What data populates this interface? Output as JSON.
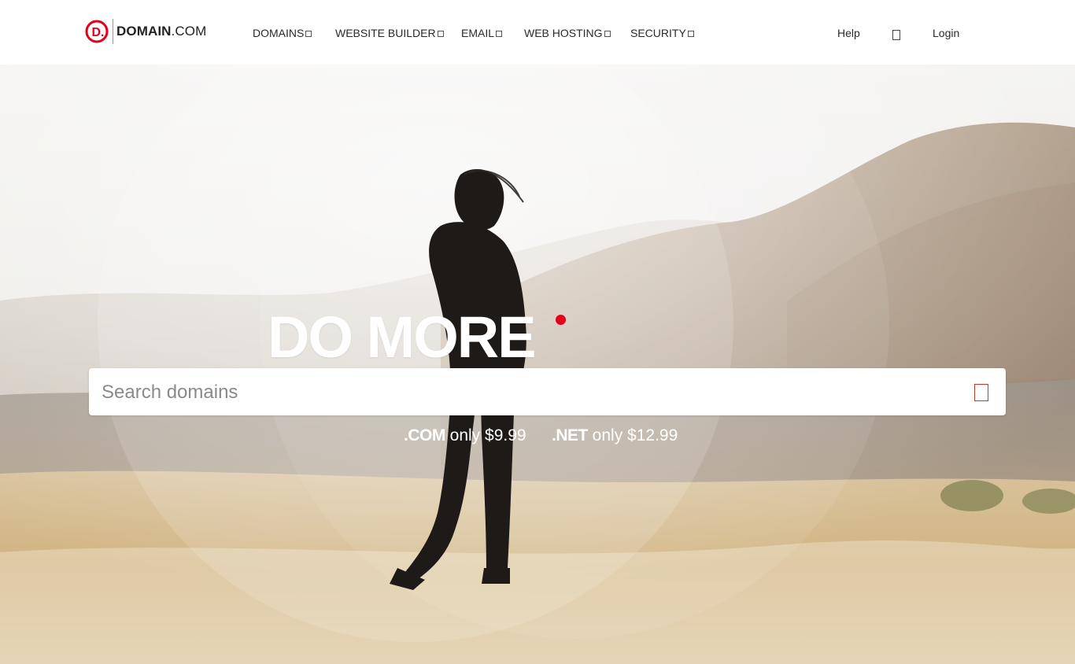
{
  "header": {
    "logo_mark": "D.",
    "logo_bold": "DOMAIN",
    "logo_suffix": ".COM",
    "nav": [
      {
        "label": "DOMAINS"
      },
      {
        "label": "WEBSITE BUILDER"
      },
      {
        "label": "EMAIL"
      },
      {
        "label": "WEB HOSTING"
      },
      {
        "label": "SECURITY"
      }
    ],
    "help_label": "Help",
    "login_label": "Login"
  },
  "hero": {
    "headline": "DO MORE",
    "accent_color": "#e3001b",
    "search": {
      "placeholder": "Search domains",
      "value": ""
    },
    "pricing": [
      {
        "tld": ".COM",
        "text": " only $9.99"
      },
      {
        "tld": ".NET",
        "text": " only $12.99"
      }
    ]
  },
  "icons": {
    "search": "search-icon",
    "cart": "cart-icon",
    "caret": "chevron-down-icon"
  }
}
